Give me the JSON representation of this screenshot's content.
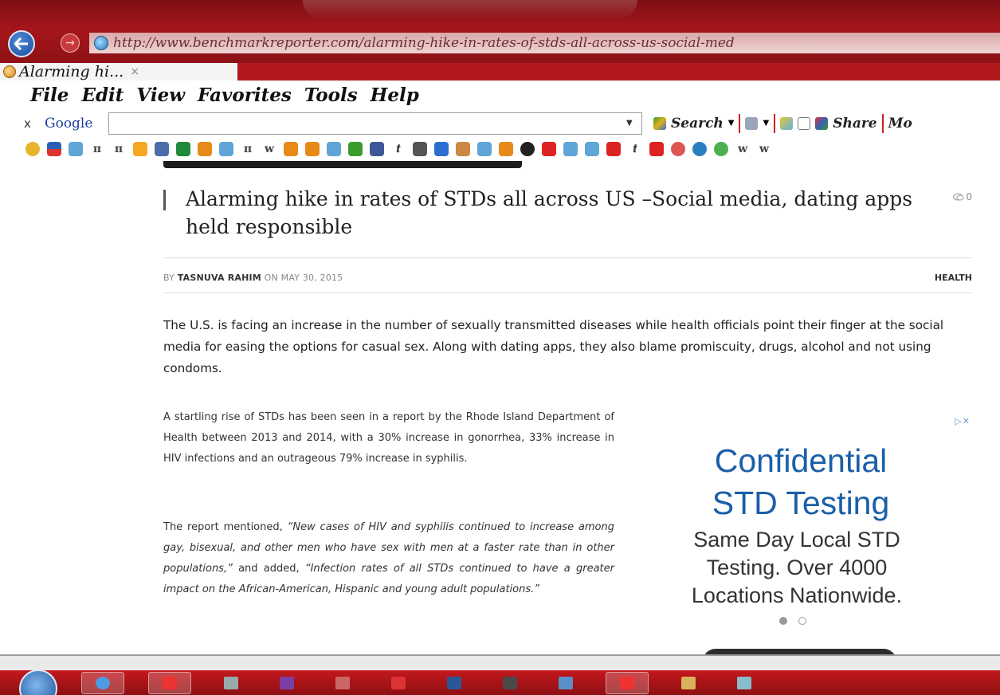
{
  "browser": {
    "url": "http://www.benchmarkreporter.com/alarming-hike-in-rates-of-stds-all-across-us-social-med",
    "tab_title": "Alarming hi...",
    "tab_close": "×",
    "menu": [
      "File",
      "Edit",
      "View",
      "Favorites",
      "Tools",
      "Help"
    ],
    "google_toolbar": {
      "close": "x",
      "brand": "Google",
      "search_label": "Search",
      "share_label": "Share",
      "more_label": "Mo"
    }
  },
  "article": {
    "headline": "Alarming hike in rates of STDs all across US –Social media, dating apps held responsible",
    "comment_count": "0",
    "byline_prefix": "BY",
    "author": "TASNUVA RAHIM",
    "date_prefix": "ON",
    "date": "MAY 30, 2015",
    "category": "HEALTH",
    "lead": "The U.S. is facing an increase in the number of sexually transmitted diseases while health officials point their finger at the social media for easing the options for casual sex. Along with dating apps, they also blame promiscuity, drugs, alcohol and not using condoms.",
    "paragraph1": "A startling rise of STDs has been seen in a report by the Rhode Island Department of Health between 2013 and 2014, with a 30% increase in gonorrhea, 33% increase in HIV infections and an outrageous 79% increase in syphilis.",
    "paragraph2_lead": "The report mentioned, ",
    "paragraph2_quote1": "“New cases of HIV and syphilis continued to increase among gay, bisexual, and other men who have sex with men at a faster rate than in other populations,”",
    "paragraph2_mid": " and added, ",
    "paragraph2_quote2": "“Infection rates of all STDs continued to have a greater impact on the African-American, Hispanic and young adult populations.”"
  },
  "ad": {
    "choices": "▷✕",
    "title_line1": "Confidential",
    "title_line2": "STD Testing",
    "sub_line1": "Same Day Local STD",
    "sub_line2": "Testing. Over 4000",
    "sub_line3": "Locations Nationwide."
  },
  "colors": {
    "chrome_red": "#a5161b",
    "ad_blue": "#1a5fa8",
    "menu_text": "#111111"
  }
}
